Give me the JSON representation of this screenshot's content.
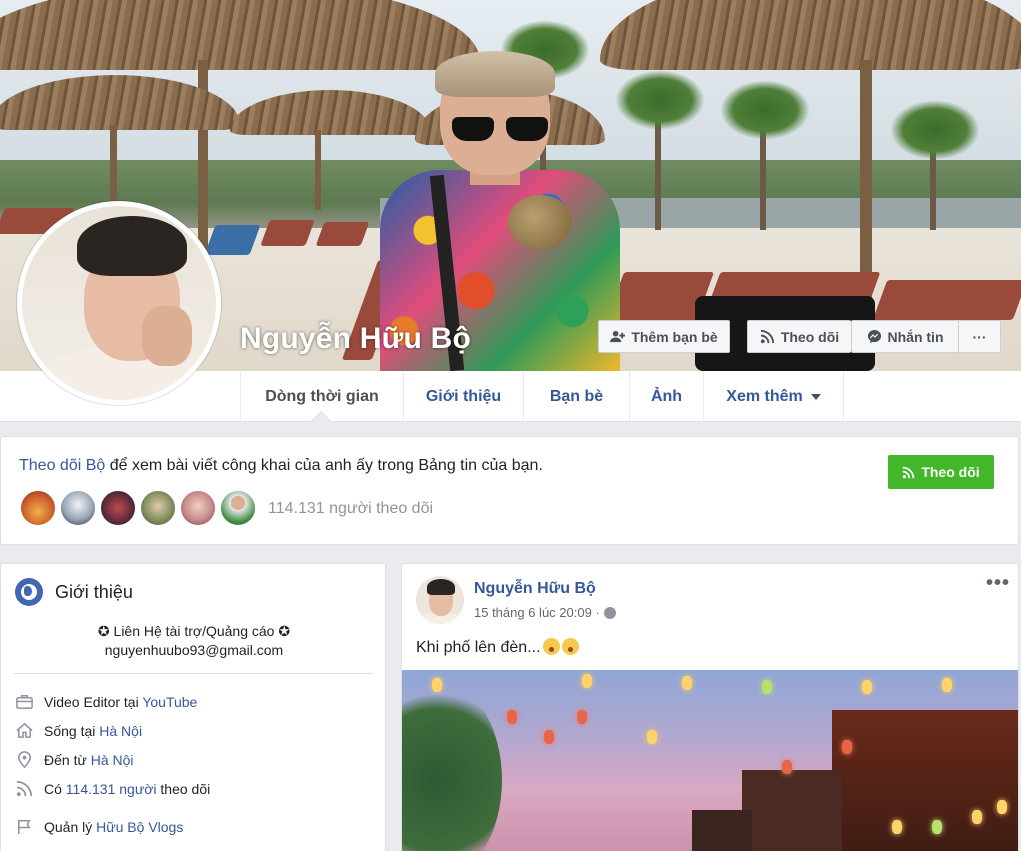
{
  "profile": {
    "name": "Nguyễn Hữu Bộ"
  },
  "cover_actions": {
    "add_friend": "Thêm bạn bè",
    "follow": "Theo dõi",
    "message": "Nhắn tin",
    "more": "···"
  },
  "nav": {
    "tabs": [
      {
        "label": "Dòng thời gian"
      },
      {
        "label": "Giới thiệu"
      },
      {
        "label": "Bạn bè"
      },
      {
        "label": "Ảnh"
      },
      {
        "label": "Xem thêm"
      }
    ]
  },
  "follow_card": {
    "link_text": "Theo dõi Bộ",
    "rest_text": " để xem bài viết công khai của anh ấy trong Bảng tin của bạn.",
    "button_label": "Theo dõi",
    "follower_count_text": "114.131 người theo dõi"
  },
  "intro": {
    "title": "Giới thiệu",
    "bio_line1": "✪ Liên Hệ tài trợ/Quảng cáo ✪",
    "bio_line2": "nguyenhuubo93@gmail.com",
    "rows": [
      {
        "icon": "briefcase-icon",
        "prefix": "Video Editor tại ",
        "link": "YouTube",
        "suffix": ""
      },
      {
        "icon": "home-icon",
        "prefix": "Sống tại ",
        "link": "Hà Nội",
        "suffix": ""
      },
      {
        "icon": "location-pin-icon",
        "prefix": "Đến từ ",
        "link": "Hà Nội",
        "suffix": ""
      },
      {
        "icon": "rss-icon",
        "prefix": "Có ",
        "link": "114.131 người",
        "suffix": " theo dõi"
      },
      {
        "icon": "flag-icon",
        "prefix": "Quản lý ",
        "link": "Hữu Bộ Vlogs",
        "suffix": ""
      }
    ]
  },
  "post": {
    "author": "Nguyễn Hữu Bộ",
    "time": "15 tháng 6 lúc 20:09 ·",
    "text": "Khi phố lên đèn...",
    "menu": "•••"
  },
  "colors": {
    "link": "#365899",
    "follow_green": "#42b72a",
    "page_bg": "#e9ebee"
  }
}
